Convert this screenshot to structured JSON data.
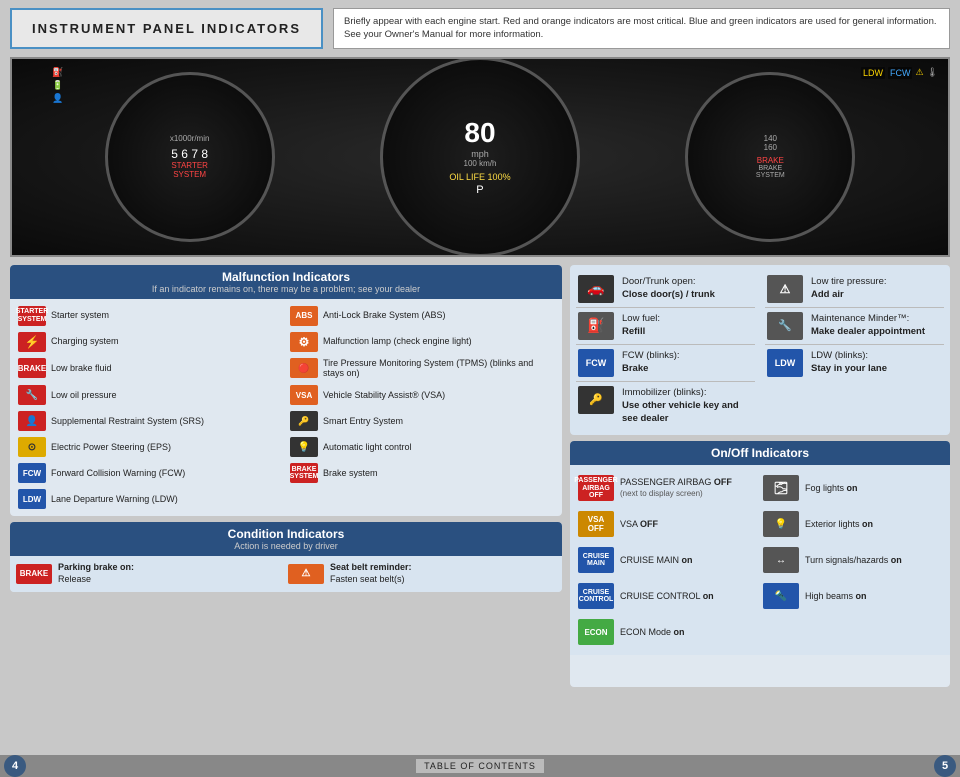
{
  "header": {
    "title": "INSTRUMENT PANEL INDICATORS",
    "description": "Briefly appear with each engine start. Red and orange indicators are most critical. Blue and green indicators are used for general information. See your Owner's Manual for more information."
  },
  "malfunction": {
    "section_title": "Malfunction Indicators",
    "section_subtitle": "If an indicator remains on, there may be a problem; see your dealer",
    "items_left": [
      {
        "icon": "STARTER SYSTEM",
        "text": "Starter system",
        "color": "red-bg"
      },
      {
        "icon": "⚡",
        "text": "Charging system",
        "color": "red-bg"
      },
      {
        "icon": "BRAKE",
        "text": "Low brake fluid",
        "color": "red-bg"
      },
      {
        "icon": "🔧",
        "text": "Low oil pressure",
        "color": "red-bg"
      },
      {
        "icon": "👤!",
        "text": "Supplemental Restraint System (SRS)",
        "color": "red-bg"
      },
      {
        "icon": "⊙!",
        "text": "Electric Power Steering (EPS)",
        "color": "yellow-bg"
      },
      {
        "icon": "FCW",
        "text": "Forward Collision Warning (FCW)",
        "color": "blue-bg"
      },
      {
        "icon": "LDW",
        "text": "Lane Departure Warning (LDW)",
        "color": "blue-bg"
      }
    ],
    "items_right": [
      {
        "icon": "ABS",
        "text": "Anti-Lock Brake System (ABS)",
        "color": "orange-bg"
      },
      {
        "icon": "🔧",
        "text": "Malfunction lamp (check engine light)",
        "color": "orange-bg"
      },
      {
        "icon": "TPMS",
        "text": "Tire Pressure Monitoring System (TPMS) (blinks and stays on)",
        "color": "orange-bg"
      },
      {
        "icon": "VSA",
        "text": "Vehicle Stability Assist® (VSA)",
        "color": "orange-bg"
      },
      {
        "icon": "🔑",
        "text": "Smart Entry System",
        "color": "dark-bg"
      },
      {
        "icon": "💡",
        "text": "Automatic light control",
        "color": "dark-bg"
      },
      {
        "icon": "BRAKE SYSTEM",
        "text": "Brake system",
        "color": "red-bg"
      }
    ]
  },
  "condition": {
    "section_title": "Condition Indicators",
    "section_subtitle": "Action is needed by driver",
    "items": [
      {
        "icon": "BRAKE",
        "text_bold": "Parking brake on:",
        "text": "Release",
        "color": "red-bg"
      },
      {
        "icon": "⚠",
        "text_bold": "Seat belt reminder:",
        "text": "Fasten seat belt(s)",
        "color": "orange-bg"
      }
    ]
  },
  "right_indicators": {
    "items": [
      {
        "icon": "🚪",
        "text_bold": "Door/Trunk open:",
        "text": "Close door(s) / trunk"
      },
      {
        "icon": "⛽",
        "text_bold": "Low fuel:",
        "text": "Refill"
      },
      {
        "icon": "FCW",
        "text_bold": "FCW (blinks):",
        "text": "Brake"
      },
      {
        "icon": "🔑",
        "text_bold": "Immobilizer (blinks):",
        "text": "Use other vehicle key and see dealer"
      }
    ],
    "items_right": [
      {
        "icon": "🔴",
        "text_bold": "Low tire pressure:",
        "text": "Add air"
      },
      {
        "icon": "🔧",
        "text_bold": "Maintenance Minder™:",
        "text": "Make dealer appointment"
      },
      {
        "icon": "LDW",
        "text_bold": "LDW (blinks):",
        "text": "Stay in your lane"
      }
    ]
  },
  "onoff": {
    "section_title": "On/Off Indicators",
    "items_left": [
      {
        "icon": "PASSENGER AIRBAG OFF",
        "text": "PASSENGER AIRBAG OFF",
        "sub": "(next to display screen)",
        "bold": "OFF",
        "color": "passenger"
      },
      {
        "icon": "VSA OFF",
        "text": "VSA OFF",
        "bold": "OFF",
        "color": "vsa"
      },
      {
        "icon": "CRUISE MAIN",
        "text": "CRUISE MAIN on",
        "bold": "on",
        "color": "cruise"
      },
      {
        "icon": "CRUISE CONTROL",
        "text": "CRUISE CONTROL on",
        "bold": "on",
        "color": "cruise-ctrl"
      },
      {
        "icon": "ECON",
        "text": "ECON Mode on",
        "bold": "on",
        "color": "econ"
      }
    ],
    "items_right": [
      {
        "icon": "FOG",
        "text": "Fog lights on",
        "bold": "on",
        "color": "fog"
      },
      {
        "icon": "EXT",
        "text": "Exterior lights on",
        "bold": "on",
        "color": "exterior"
      },
      {
        "icon": "TURN",
        "text": "Turn signals/hazards on",
        "bold": "on",
        "color": "turn"
      },
      {
        "icon": "HB",
        "text": "High beams on",
        "bold": "on",
        "color": "highbeam"
      }
    ]
  },
  "pages": {
    "left": "4",
    "right": "5",
    "toc": "TABLE OF CONTENTS"
  }
}
